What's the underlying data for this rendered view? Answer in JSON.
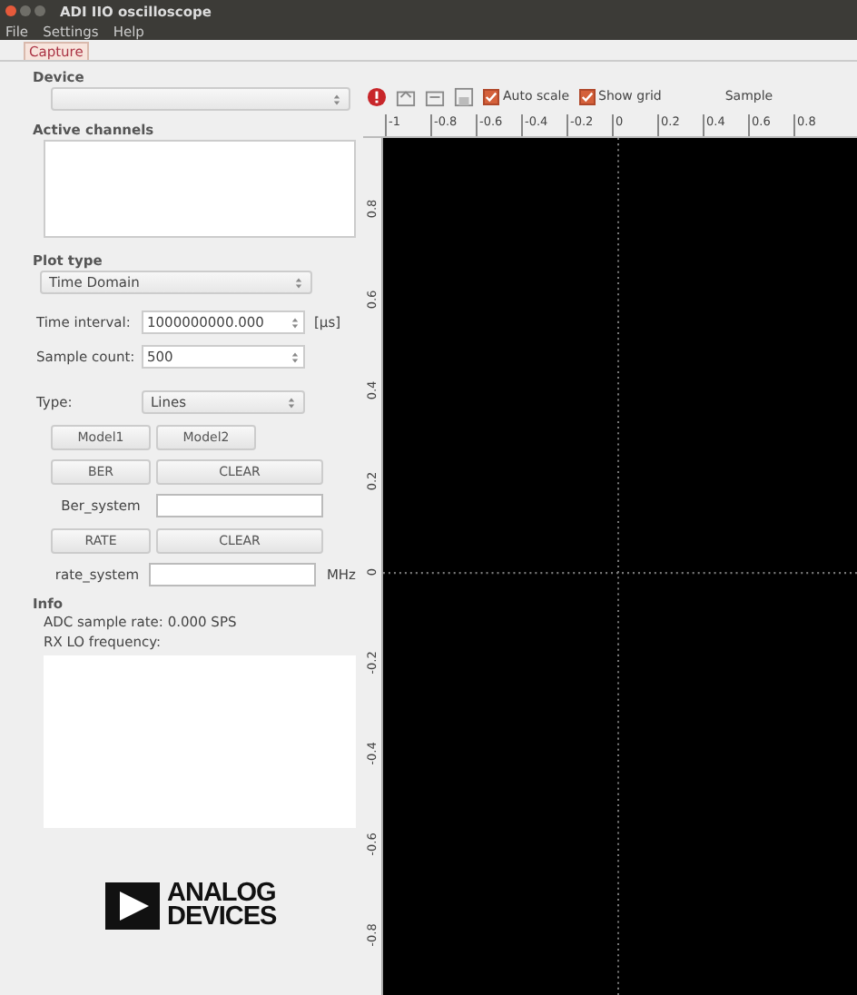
{
  "window": {
    "title": "ADI IIO oscilloscope"
  },
  "menu": [
    "File",
    "Settings",
    "Help"
  ],
  "tabs": [
    {
      "label": "Capture",
      "selected": true
    }
  ],
  "device": {
    "label": "Device"
  },
  "active_channels": {
    "label": "Active channels"
  },
  "plot_type": {
    "label": "Plot type",
    "value": "Time Domain"
  },
  "fields": [
    {
      "label": "Time interval:",
      "value": "1000000000.000",
      "unit": "[µs]"
    },
    {
      "label": "Sample count:",
      "value": "500"
    }
  ],
  "type": {
    "label": "Type:",
    "value": "Lines"
  },
  "model_buttons": [
    "Model1",
    "Model2"
  ],
  "ber": {
    "button": "BER",
    "clear": "CLEAR",
    "label": "Ber_system"
  },
  "rate": {
    "button": "RATE",
    "clear": "CLEAR",
    "label": "rate_system",
    "unit": "MHz"
  },
  "info": {
    "label": "Info",
    "lines": [
      "ADC sample rate: 0.000 SPS",
      "RX LO frequency:"
    ]
  },
  "logo": {
    "line1": "ANALOG",
    "line2": "DEVICES"
  },
  "toolbar": {
    "checks": [
      {
        "label": "Auto scale",
        "checked": true
      },
      {
        "label": "Show grid",
        "checked": true
      }
    ],
    "samples_label": "Sample"
  },
  "plot": {
    "x_ticks": [
      "-1",
      "-0.8",
      "-0.6",
      "-0.4",
      "-0.2",
      "0",
      "0.2",
      "0.4",
      "0.6",
      "0.8"
    ],
    "y_ticks": [
      "0.8",
      "0.6",
      "0.4",
      "0.2",
      "0",
      "-0.2",
      "-0.4",
      "-0.6",
      "-0.8"
    ]
  }
}
